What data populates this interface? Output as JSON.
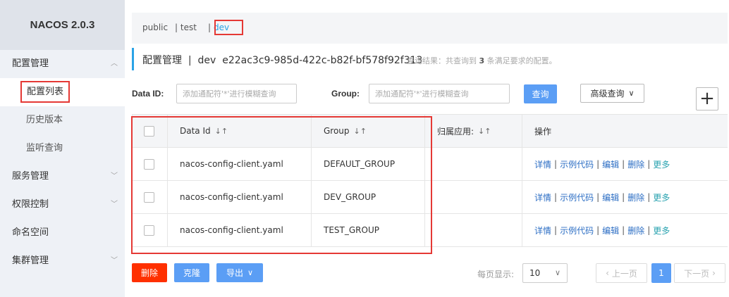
{
  "brand": "NACOS 2.0.3",
  "sidebar": {
    "config_mgmt": "配置管理",
    "config_list": "配置列表",
    "history": "历史版本",
    "listen_query": "监听查询",
    "service_mgmt": "服务管理",
    "auth_control": "权限控制",
    "namespace": "命名空间",
    "cluster_mgmt": "集群管理"
  },
  "namespaces": {
    "public": "public",
    "test": "| test",
    "sep": "|",
    "dev": "dev"
  },
  "title": {
    "text": "配置管理  |  dev  e22ac3c9-985d-422c-b82f-bf578f92f313",
    "hint_prefix": "查询结果：共查询到 ",
    "hint_count": "3",
    "hint_suffix": " 条满足要求的配置。"
  },
  "filter": {
    "data_id_label": "Data ID:",
    "data_id_placeholder": "添加通配符'*'进行模糊查询",
    "group_label": "Group:",
    "group_placeholder": "添加通配符'*'进行模糊查询",
    "query_button": "查询",
    "advanced_button": "高级查询"
  },
  "table": {
    "headers": {
      "data_id": "Data Id",
      "group": "Group",
      "app": "归属应用:",
      "ops": "操作"
    },
    "rows": [
      {
        "data_id": "nacos-config-client.yaml",
        "group": "DEFAULT_GROUP",
        "app": ""
      },
      {
        "data_id": "nacos-config-client.yaml",
        "group": "DEV_GROUP",
        "app": ""
      },
      {
        "data_id": "nacos-config-client.yaml",
        "group": "TEST_GROUP",
        "app": ""
      }
    ],
    "ops": {
      "detail": "详情",
      "sample": "示例代码",
      "edit": "编辑",
      "delete": "删除",
      "more": "更多",
      "sep": "|"
    }
  },
  "footer": {
    "delete": "删除",
    "clone": "克隆",
    "export": "导出",
    "page_size_label": "每页显示:",
    "page_size": "10",
    "prev": "上一页",
    "page": "1",
    "next": "下一页"
  }
}
